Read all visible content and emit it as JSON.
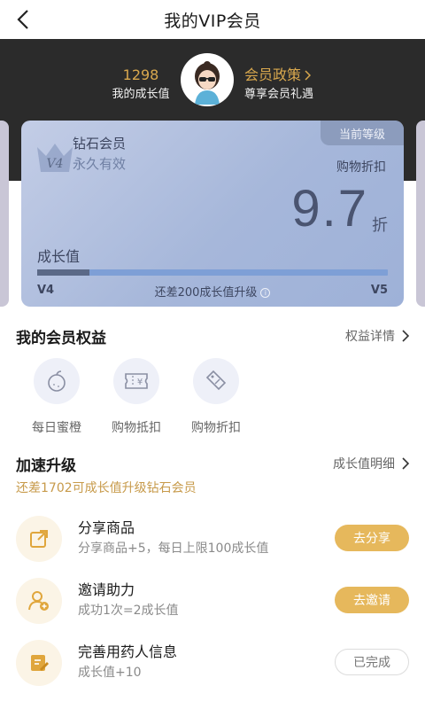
{
  "header": {
    "title": "我的VIP会员"
  },
  "hero": {
    "growth_value": "1298",
    "growth_label": "我的成长值",
    "policy_title": "会员政策",
    "policy_sub": "尊享会员礼遇"
  },
  "card": {
    "badge": "当前等级",
    "level_icon_text": "V4",
    "level_name": "钻石会员",
    "validity": "永久有效",
    "discount_label": "购物折扣",
    "discount_value": "9.7",
    "discount_unit": "折",
    "growth_label": "成长值",
    "progress_fraction": 0.15,
    "from_level": "V4",
    "to_level": "V5",
    "upgrade_tip": "还差200成长值升级"
  },
  "benefits": {
    "title": "我的会员权益",
    "link": "权益详情",
    "items": [
      {
        "label": "每日蜜橙",
        "icon": "orange-icon"
      },
      {
        "label": "购物抵扣",
        "icon": "coupon-yuan-icon"
      },
      {
        "label": "购物折扣",
        "icon": "discount-tag-icon"
      }
    ]
  },
  "accelerate": {
    "title": "加速升级",
    "link": "成长值明细",
    "tip": "还差1702可成长值升级钻石会员",
    "tasks": [
      {
        "title": "分享商品",
        "desc": "分享商品+5，每日上限100成长值",
        "button": "去分享",
        "icon": "share-icon",
        "done": false
      },
      {
        "title": "邀请助力",
        "desc": "成功1次=2成长值",
        "button": "去邀请",
        "icon": "invite-user-icon",
        "done": false
      },
      {
        "title": "完善用药人信息",
        "desc": "成长值+10",
        "button": "已完成",
        "icon": "edit-document-icon",
        "done": true
      }
    ]
  },
  "colors": {
    "gold": "#e6b85c",
    "dark": "#2b2b2b",
    "accent_text": "#c79a4a"
  }
}
